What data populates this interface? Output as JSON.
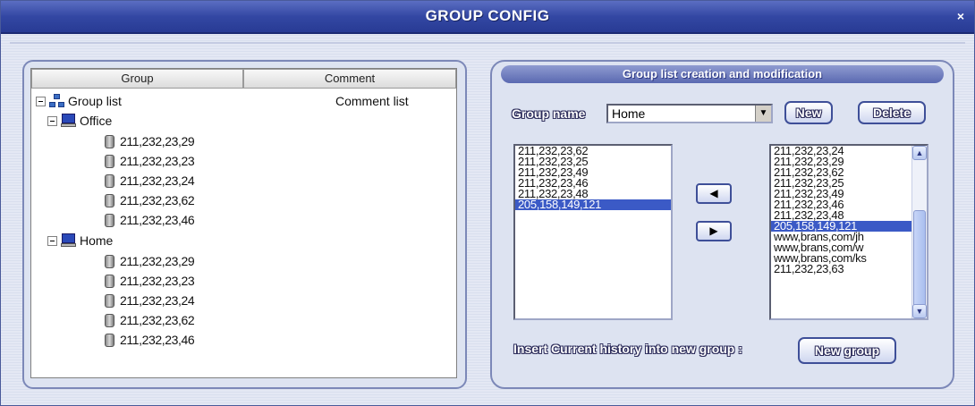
{
  "window": {
    "title": "GROUP CONFIG",
    "close_label": "×"
  },
  "left": {
    "columns": [
      "Group",
      "Comment"
    ],
    "root": {
      "label": "Group list",
      "comment": "Comment list"
    },
    "groups": [
      {
        "name": "Office",
        "hosts": [
          "211,232,23,29",
          "211,232,23,23",
          "211,232,23,24",
          "211,232,23,62",
          "211,232,23,46"
        ]
      },
      {
        "name": "Home",
        "hosts": [
          "211,232,23,29",
          "211,232,23,23",
          "211,232,23,24",
          "211,232,23,62",
          "211,232,23,46"
        ]
      }
    ]
  },
  "right": {
    "title": "Group list creation and modification",
    "group_name_label": "Group name",
    "group_name_value": "Home",
    "new_label": "New",
    "delete_label": "Delete",
    "left_list": [
      "211,232,23,62",
      "211,232,23,25",
      "211,232,23,49",
      "211,232,23,46",
      "211,232,23,48",
      "205,158,149,121"
    ],
    "left_list_selected": 5,
    "right_list": [
      "211,232,23,24",
      "211,232,23,29",
      "211,232,23,62",
      "211,232,23,25",
      "211,232,23,49",
      "211,232,23,46",
      "211,232,23,48",
      "205,158,149,121",
      "www,brans,com/jh",
      "www,brans,com/w",
      "www,brans,com/ks",
      "211,232,23,63"
    ],
    "right_list_selected": 7,
    "move_left_label": "◀",
    "move_right_label": "▶",
    "insert_label": "Insert Current history into new group :",
    "new_group_label": "New group"
  },
  "colors": {
    "title_bar": "#3347a3",
    "selection": "#3b5ac6",
    "panel_border": "#7c88b8"
  }
}
